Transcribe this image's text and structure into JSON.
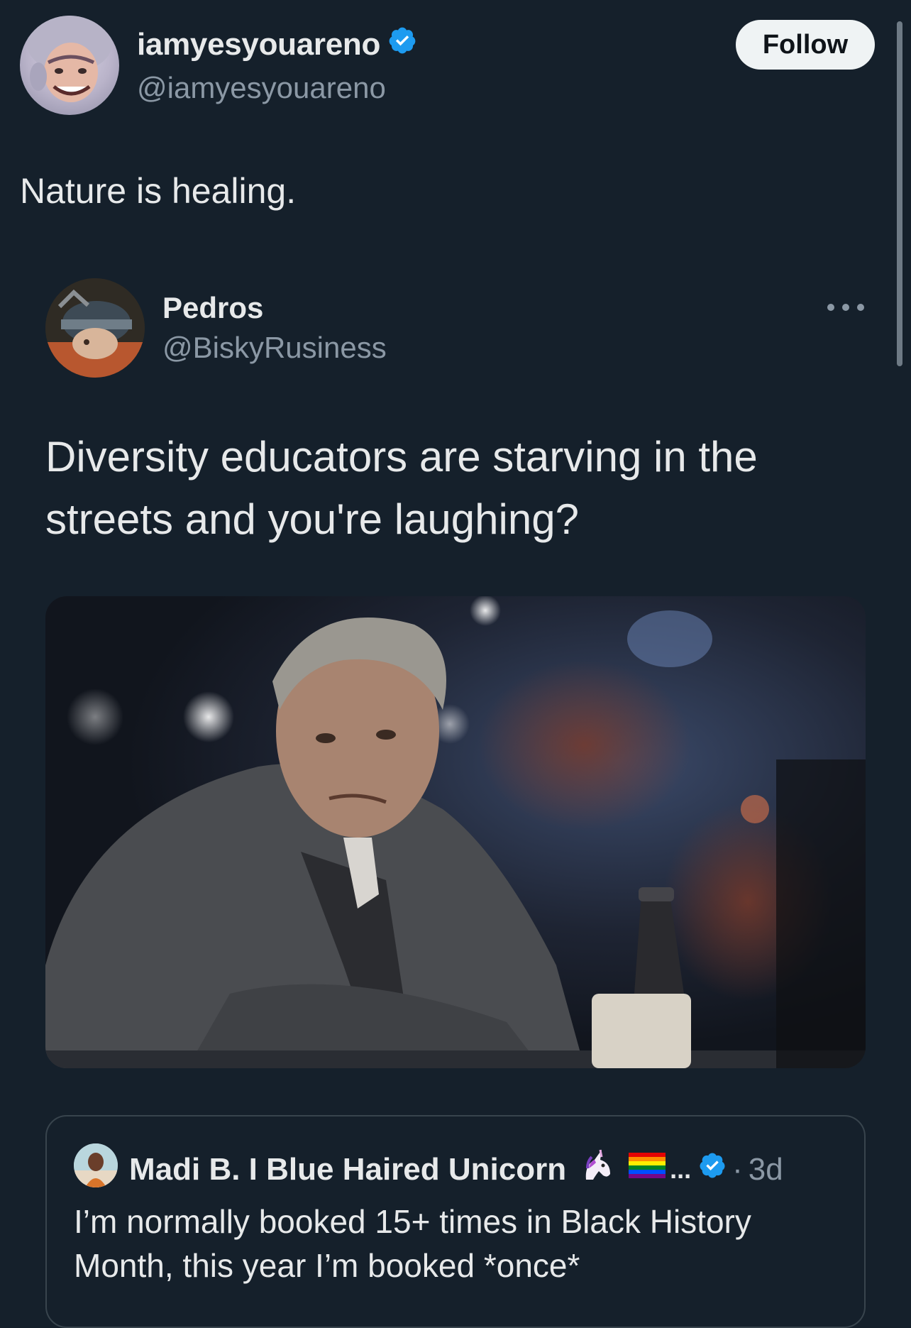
{
  "author": {
    "display_name": "iamyesyouareno",
    "handle": "@iamyesyouareno",
    "verified": true,
    "avatar_icon": "cartoon-face-avatar"
  },
  "follow_button": {
    "label": "Follow"
  },
  "tweet": {
    "text": "Nature is healing."
  },
  "quoted_tweet": {
    "display_name": "Pedros",
    "handle": "@BiskyRusiness",
    "avatar_icon": "medieval-helmet-avatar",
    "more_icon": "more-horizontal-icon",
    "text": "Diversity educators are starving in the streets and you're laughing?",
    "media_icon": "man-at-bar-photo"
  },
  "nested_quote": {
    "display_name": "Madi B. I Blue Haired Unicorn",
    "ellipsis": "...",
    "verified": true,
    "separator": "·",
    "time": "3d",
    "text": "I’m normally booked 15+ times in Black History Month, this year I’m booked *once*",
    "emoji_icons": [
      "unicorn-icon",
      "rainbow-flag-icon"
    ]
  },
  "colors": {
    "background": "#15202b",
    "text": "#e7e9ea",
    "secondary_text": "#8b98a5",
    "verified_blue": "#1d9bf0",
    "border": "#38444d"
  }
}
